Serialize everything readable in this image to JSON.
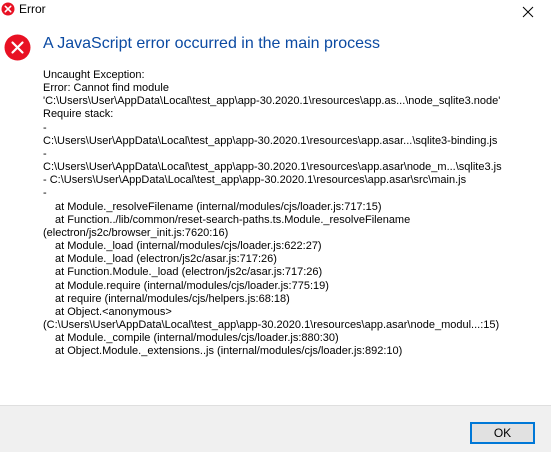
{
  "window": {
    "title": "Error",
    "close_icon": "close-icon",
    "title_icon": "error-icon"
  },
  "colors": {
    "error_red": "#e81123",
    "heading_blue": "#0b4aa2",
    "footer_bg": "#f0f0f0",
    "button_border": "#0078d7"
  },
  "dialog": {
    "heading": "A JavaScript error occurred in the main process",
    "icon": "error-icon",
    "lines": [
      "Uncaught Exception:",
      "Error: Cannot find module",
      "'C:\\Users\\User\\AppData\\Local\\test_app\\app-30.2020.1\\resources\\app.as...\\node_sqlite3.node'",
      "Require stack:",
      "-",
      "C:\\Users\\User\\AppData\\Local\\test_app\\app-30.2020.1\\resources\\app.asar...\\sqlite3-binding.js",
      "-",
      "C:\\Users\\User\\AppData\\Local\\test_app\\app-30.2020.1\\resources\\app.asar\\node_m...\\sqlite3.js",
      "- C:\\Users\\User\\AppData\\Local\\test_app\\app-30.2020.1\\resources\\app.asar\\src\\main.js",
      "-",
      "at Module._resolveFilename (internal/modules/cjs/loader.js:717:15)",
      "at Function../lib/common/reset-search-paths.ts.Module._resolveFilename",
      "(electron/js2c/browser_init.js:7620:16)",
      "at Module._load (internal/modules/cjs/loader.js:622:27)",
      "at Module._load (electron/js2c/asar.js:717:26)",
      "at Function.Module._load (electron/js2c/asar.js:717:26)",
      "at Module.require (internal/modules/cjs/loader.js:775:19)",
      "at require (internal/modules/cjs/helpers.js:68:18)",
      "at Object.<anonymous>",
      "(C:\\Users\\User\\AppData\\Local\\test_app\\app-30.2020.1\\resources\\app.asar\\node_modul...:15)",
      "at Module._compile (internal/modules/cjs/loader.js:880:30)",
      "at Object.Module._extensions..js (internal/modules/cjs/loader.js:892:10)"
    ]
  },
  "footer": {
    "ok_label": "OK"
  }
}
